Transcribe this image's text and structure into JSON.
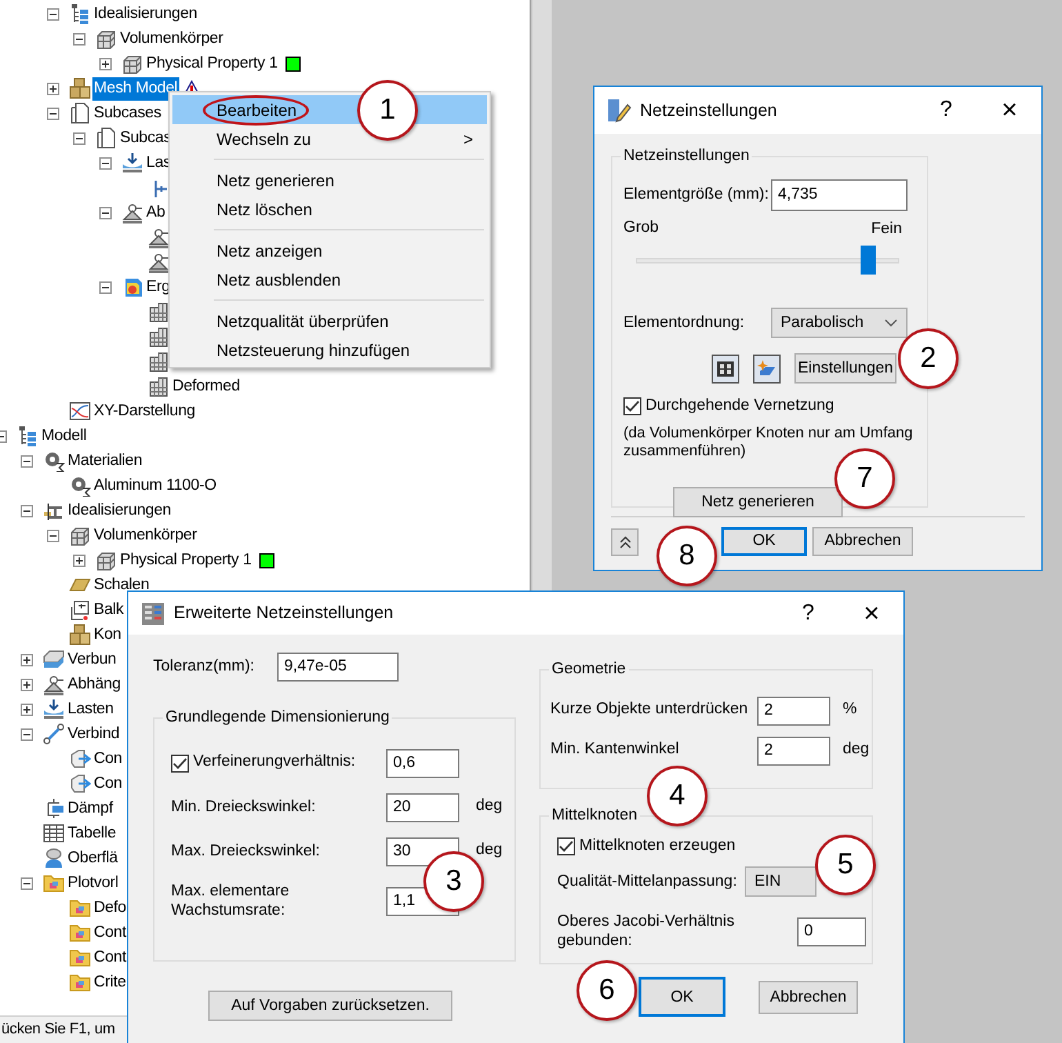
{
  "tree_upper": [
    {
      "label": "Idealisierungen",
      "kind": "idealizations",
      "expanded": true,
      "selected": false,
      "children": [
        {
          "label": "Volumenkörper",
          "kind": "solid",
          "expanded": true,
          "selected": false,
          "children": [
            {
              "label": "Physical Property 1",
              "kind": "solid",
              "expanded": false,
              "selected": false,
              "color": "#00ff00"
            }
          ]
        }
      ]
    },
    {
      "label": "Mesh Model",
      "kind": "mesh_model",
      "expanded": false,
      "selected": true,
      "warning": true
    },
    {
      "label": "Subcases",
      "kind": "subcases",
      "expanded": true,
      "selected": false,
      "children": [
        {
          "label": "Subcas",
          "kind": "subcases",
          "expanded": true,
          "selected": false,
          "children": [
            {
              "label": "Las",
              "kind": "loads",
              "expanded": true,
              "selected": false,
              "children": [
                {
                  "kind": "fixed_load"
                }
              ]
            },
            {
              "label": "Ab",
              "kind": "constraints",
              "expanded": true,
              "selected": false,
              "children": [
                {
                  "kind": "constraints"
                },
                {
                  "kind": "constraints"
                }
              ]
            },
            {
              "label": "Erg",
              "kind": "results",
              "expanded": true,
              "selected": false,
              "children": [
                {
                  "kind": "result"
                },
                {
                  "kind": "result"
                },
                {
                  "kind": "result"
                },
                {
                  "label": "Deformed",
                  "kind": "result",
                  "selected": false
                }
              ]
            }
          ]
        }
      ]
    },
    {
      "label": "XY-Darstellung",
      "kind": "xy_plot",
      "selected": false
    }
  ],
  "tree_lower": [
    {
      "label": "Modell",
      "kind": "model",
      "expanded": true,
      "selected": false,
      "children": [
        {
          "label": "Materialien",
          "kind": "materials",
          "expanded": true,
          "selected": false,
          "children": [
            {
              "label": "Aluminum 1100-O",
              "kind": "materials",
              "selected": false
            }
          ]
        },
        {
          "label": "Idealisierungen",
          "kind": "idealizations2",
          "expanded": true,
          "selected": false,
          "children": [
            {
              "label": "Volumenkörper",
              "kind": "solid",
              "expanded": true,
              "selected": false,
              "children": [
                {
                  "label": "Physical Property 1",
                  "kind": "solid",
                  "expanded": false,
                  "selected": false,
                  "color": "#00ff00"
                }
              ]
            },
            {
              "label": "Schalen",
              "kind": "shells",
              "selected": false
            },
            {
              "label": "Balk",
              "kind": "beams",
              "selected": false
            },
            {
              "label": "Kon",
              "kind": "mesh_model",
              "selected": false
            }
          ]
        },
        {
          "label": "Verbun",
          "kind": "contacts",
          "expanded": false,
          "selected": false
        },
        {
          "label": "Abhäng",
          "kind": "constraints",
          "expanded": false,
          "selected": false
        },
        {
          "label": "Lasten",
          "kind": "loads",
          "expanded": false,
          "selected": false
        },
        {
          "label": "Verbind",
          "kind": "connectors",
          "expanded": true,
          "selected": false,
          "children": [
            {
              "label": "Con",
              "kind": "connector",
              "selected": false
            },
            {
              "label": "Con",
              "kind": "connector",
              "selected": false
            }
          ]
        },
        {
          "label": "Dämpf",
          "kind": "dampers",
          "selected": false
        },
        {
          "label": "Tabelle",
          "kind": "tables",
          "selected": false
        },
        {
          "label": "Oberflä",
          "kind": "surfaces",
          "selected": false
        },
        {
          "label": "Plotvorl",
          "kind": "folder",
          "expanded": true,
          "selected": false,
          "children": [
            {
              "label": "Defo",
              "kind": "folder",
              "selected": false
            },
            {
              "label": "Cont",
              "kind": "folder",
              "selected": false
            },
            {
              "label": "Cont",
              "kind": "folder",
              "selected": false
            },
            {
              "label": "Crite",
              "kind": "folder",
              "selected": false
            }
          ]
        }
      ]
    }
  ],
  "status_bar": {
    "text": "ücken Sie F1, um"
  },
  "context_menu": {
    "items": [
      {
        "kind": "item",
        "label": "Bearbeiten",
        "selected": true,
        "circled": true
      },
      {
        "kind": "submenu",
        "label": "Wechseln zu",
        "arrow": ">",
        "selected": false
      },
      {
        "kind": "separator"
      },
      {
        "kind": "item",
        "label": "Netz generieren",
        "selected": false
      },
      {
        "kind": "item",
        "label": "Netz löschen",
        "selected": false
      },
      {
        "kind": "separator"
      },
      {
        "kind": "item",
        "label": "Netz anzeigen",
        "selected": false
      },
      {
        "kind": "item",
        "label": "Netz ausblenden",
        "selected": false
      },
      {
        "kind": "separator"
      },
      {
        "kind": "item",
        "label": "Netzqualität überprüfen",
        "selected": false
      },
      {
        "kind": "item",
        "label": "Netzsteuerung hinzufügen",
        "selected": false
      }
    ]
  },
  "mesh_dialog": {
    "title": "Netzeinstellungen",
    "help": "?",
    "close": "×",
    "group": "Netzeinstellungen",
    "element_size": {
      "label": "Elementgröße (mm):",
      "value": "4,735"
    },
    "coarse": "Grob",
    "fine": "Fein",
    "slider": {
      "level": 0.88
    },
    "element_order": {
      "label": "Elementordnung:",
      "value": "Parabolisch"
    },
    "settings_button": "Einstellungen",
    "continuous": {
      "label": "Durchgehende Vernetzung",
      "checked": true
    },
    "note": "(da Volumenkörper Knoten nur am Umfang zusammenführen)",
    "generate_button": "Netz generieren",
    "ok": "OK",
    "cancel": "Abbrechen"
  },
  "advanced_dialog": {
    "title": "Erweiterte Netzeinstellungen",
    "help": "?",
    "close": "×",
    "tolerance": {
      "label": "Toleranz(mm):",
      "value": "9,47e-05"
    },
    "basic_group": {
      "title": "Grundlegende Dimensionierung",
      "rows": [
        {
          "kind": "check",
          "label": "Verfeinerungverhältnis:",
          "checked": true,
          "value": "0,6"
        },
        {
          "kind": "field",
          "label": "Min. Dreieckswinkel:",
          "value": "20",
          "unit": "deg"
        },
        {
          "kind": "field",
          "label": "Max. Dreieckswinkel:",
          "value": "30",
          "unit": "deg"
        },
        {
          "kind": "field",
          "label": "Max. elementare Wachstumsrate:",
          "value": "1,1"
        }
      ]
    },
    "reset_button": "Auf Vorgaben zurücksetzen.",
    "geometry_group": {
      "title": "Geometrie",
      "rows": [
        {
          "label": "Kurze Objekte unterdrücken",
          "value": "2",
          "unit": "%"
        },
        {
          "label": "Min. Kantenwinkel",
          "value": "2",
          "unit": "deg"
        }
      ]
    },
    "midnode_group": {
      "title": "Mittelknoten",
      "create": {
        "label": "Mittelknoten erzeugen",
        "checked": true
      },
      "quality": {
        "label": "Qualität-Mittelanpassung:",
        "value": "EIN"
      },
      "jacobi": {
        "label": "Oberes Jacobi-Verhältnis gebunden:",
        "value": "0"
      }
    },
    "ok": "OK",
    "cancel": "Abbrechen"
  },
  "callouts": [
    {
      "label": "1"
    },
    {
      "label": "2"
    },
    {
      "label": "7"
    },
    {
      "label": "8"
    },
    {
      "label": "3"
    },
    {
      "label": "4"
    },
    {
      "label": "5"
    },
    {
      "label": "6"
    }
  ]
}
